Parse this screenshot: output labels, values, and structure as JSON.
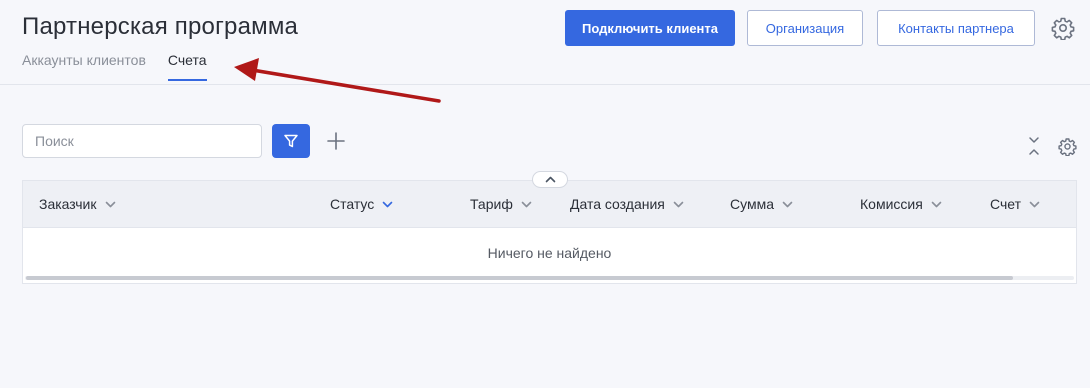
{
  "header": {
    "title": "Партнерская программа",
    "tabs": [
      {
        "label": "Аккаунты клиентов",
        "active": false
      },
      {
        "label": "Счета",
        "active": true
      }
    ],
    "buttons": {
      "connect_client": "Подключить клиента",
      "organization": "Организация",
      "partner_contacts": "Контакты партнера"
    }
  },
  "toolbar": {
    "search_placeholder": "Поиск"
  },
  "table": {
    "columns": [
      {
        "label": "Заказчик"
      },
      {
        "label": "Статус"
      },
      {
        "label": "Тариф"
      },
      {
        "label": "Дата создания"
      },
      {
        "label": "Сумма"
      },
      {
        "label": "Комиссия"
      },
      {
        "label": "Счет"
      }
    ],
    "empty_message": "Ничего не найдено"
  },
  "colors": {
    "accent": "#3568e0",
    "annotation_arrow": "#b01818"
  },
  "icons": [
    "gear-icon",
    "filter-icon",
    "plus-icon",
    "collapse-icon",
    "chevron-down-icon",
    "chevron-up-icon"
  ]
}
